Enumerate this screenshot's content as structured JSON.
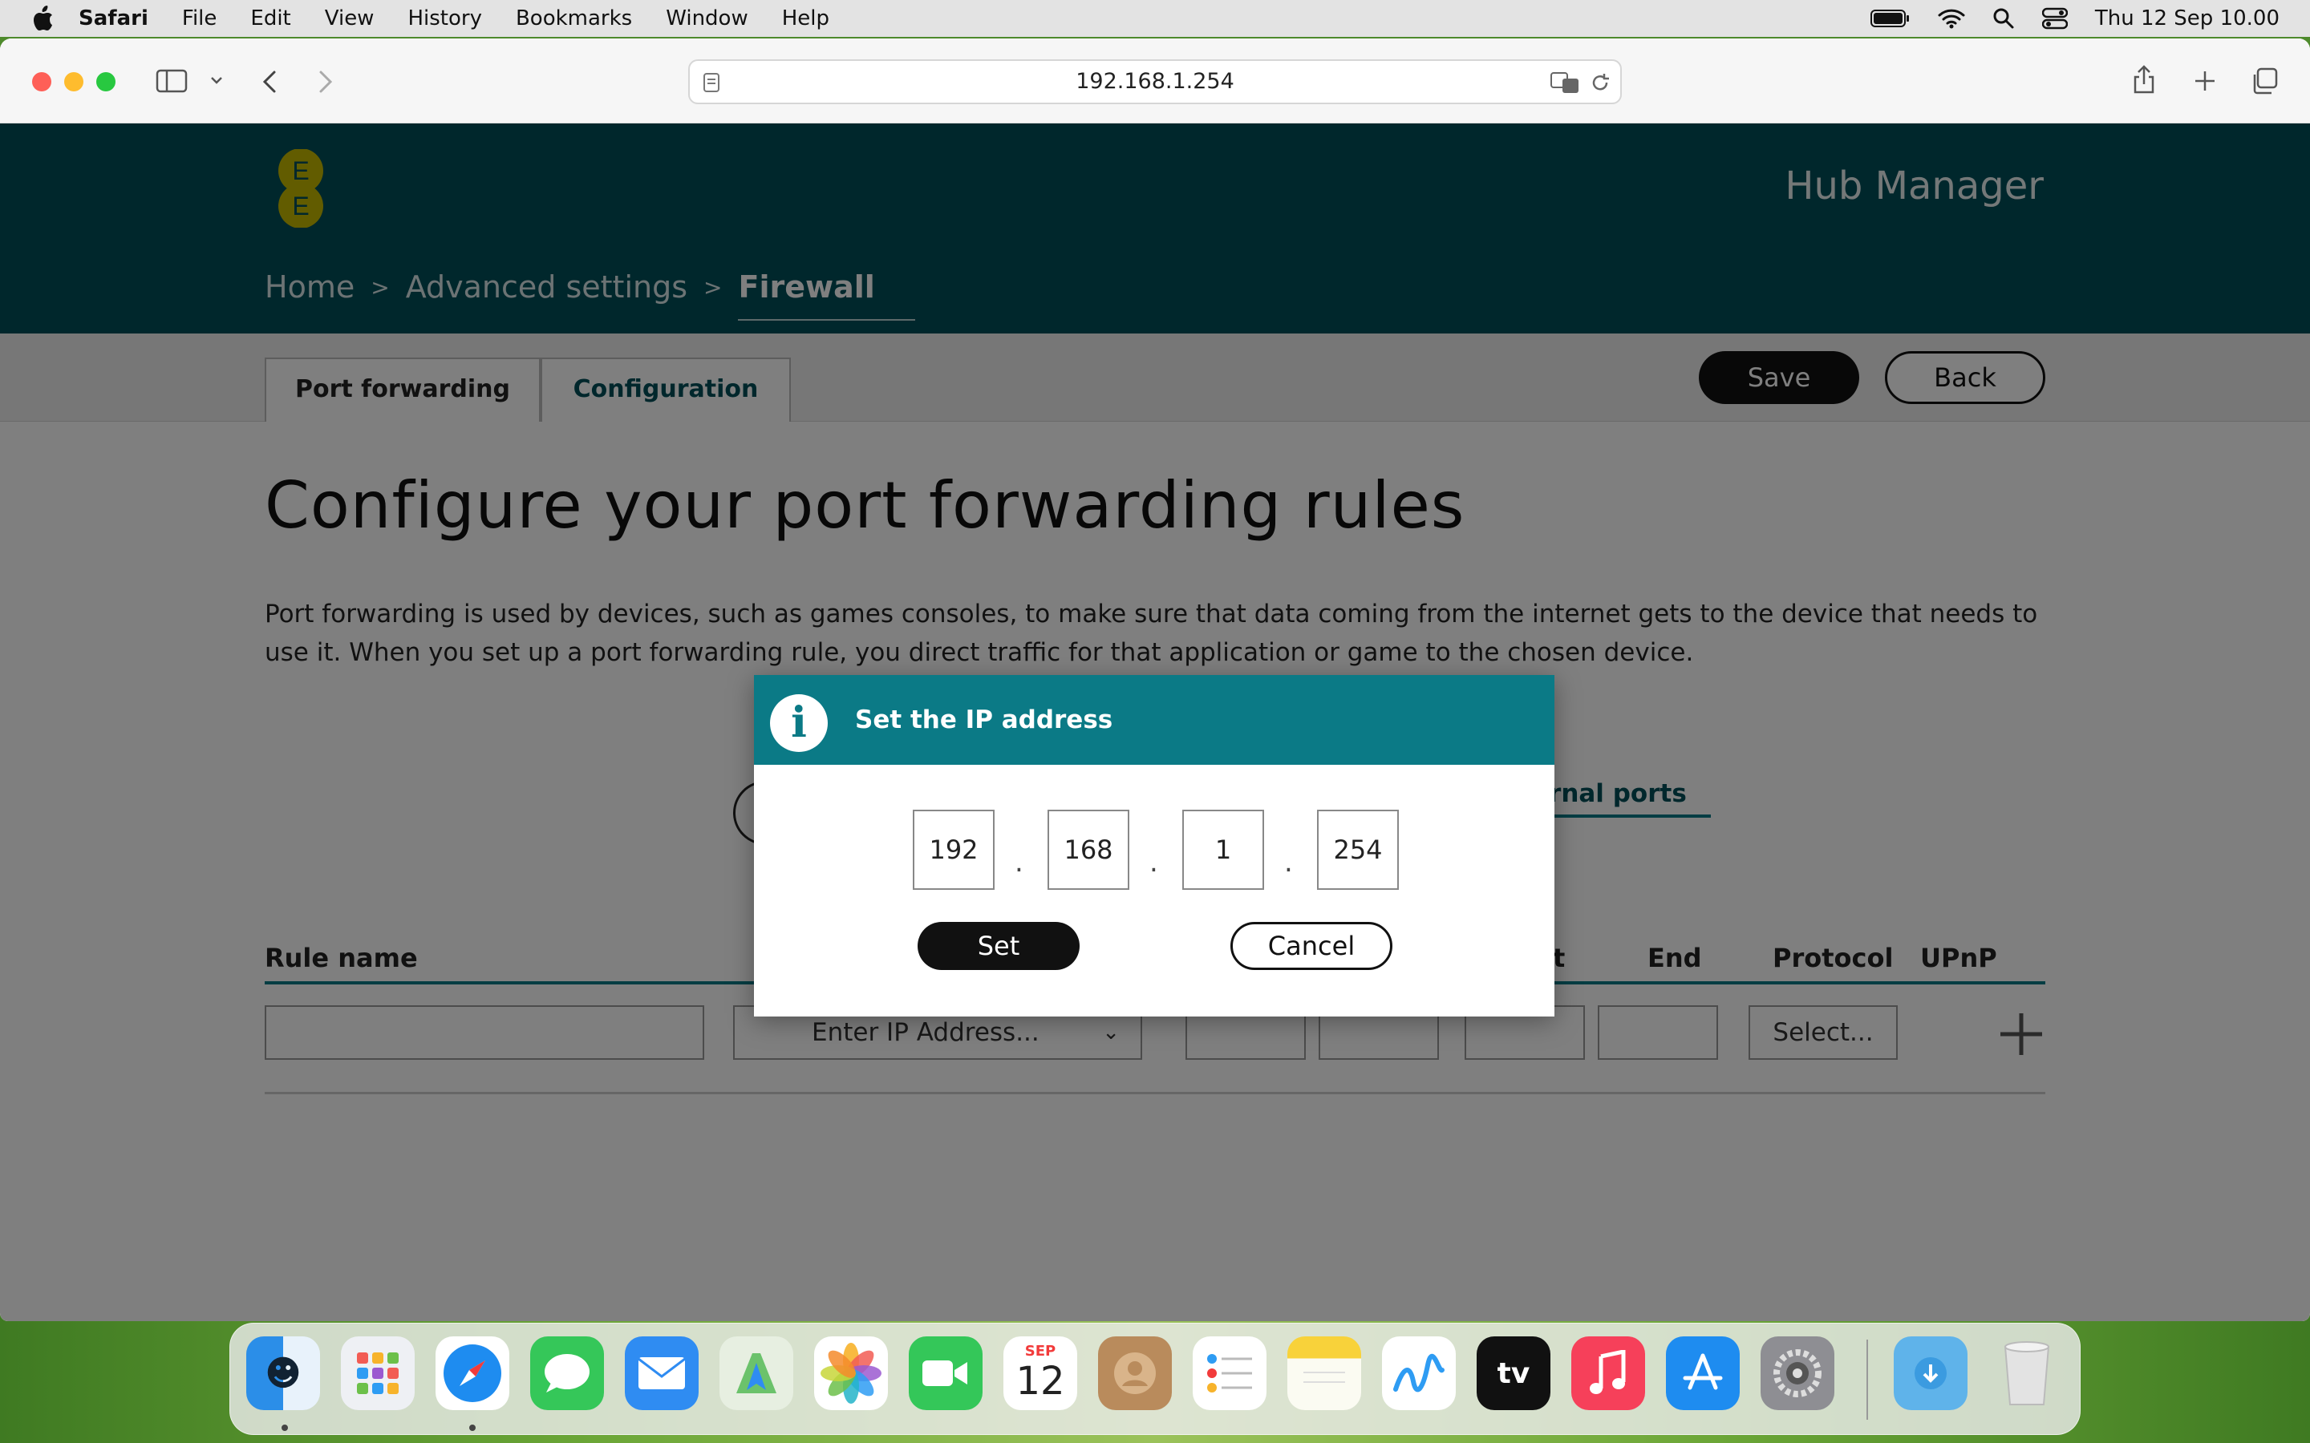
{
  "menubar": {
    "app": "Safari",
    "items": [
      "File",
      "Edit",
      "View",
      "History",
      "Bookmarks",
      "Window",
      "Help"
    ],
    "clock": "Thu 12 Sep  10.00"
  },
  "browser": {
    "address": "192.168.1.254"
  },
  "site": {
    "brand_letters": [
      "E",
      "E"
    ],
    "title": "Hub Manager",
    "breadcrumbs": [
      "Home",
      "Advanced settings",
      "Firewall"
    ],
    "tabs": [
      "Port forwarding",
      "Configuration"
    ],
    "save_label": "Save",
    "back_label": "Back"
  },
  "main": {
    "heading": "Configure your port forwarding rules",
    "description": "Port forwarding is used by devices, such as games consoles, to make sure that data coming from the internet gets to the device that needs to use it. When you set up a port forwarding rule, you direct traffic for that application or game to the chosen device.",
    "subhead": "ernal ports",
    "columns": {
      "rule_name": "Rule name",
      "start_partial": "t",
      "end": "End",
      "protocol": "Protocol",
      "upnp": "UPnP"
    },
    "ip_select": "Enter IP Address...",
    "protocol_select": "Select..."
  },
  "dialog": {
    "title": "Set the IP address",
    "icon_glyph": "i",
    "octets": [
      "192",
      "168",
      "1",
      "254"
    ],
    "separator": ".",
    "set_label": "Set",
    "cancel_label": "Cancel"
  },
  "dock": {
    "calendar_month": "SEP",
    "calendar_day": "12",
    "tv_label": "tv"
  }
}
